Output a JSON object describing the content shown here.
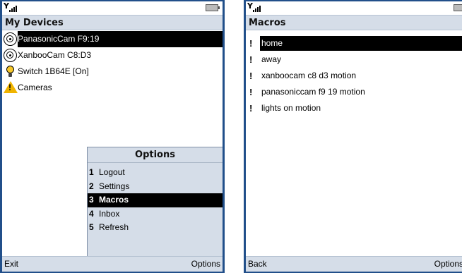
{
  "left_screen": {
    "title": "My Devices",
    "signal_glyph": "Y",
    "items": [
      {
        "label": "PanasonicCam F9:19",
        "icon": "camera-icon",
        "selected": true
      },
      {
        "label": "XanbooCam C8:D3",
        "icon": "camera-icon",
        "selected": false
      },
      {
        "label": "Switch 1B64E [On]",
        "icon": "lightbulb-icon",
        "selected": false
      },
      {
        "label": "Cameras",
        "icon": "warning-icon",
        "selected": false
      }
    ],
    "menu": {
      "title": "Options",
      "items": [
        {
          "num": "1",
          "label": "Logout"
        },
        {
          "num": "2",
          "label": "Settings"
        },
        {
          "num": "3",
          "label": "Macros",
          "selected": true
        },
        {
          "num": "4",
          "label": "Inbox"
        },
        {
          "num": "5",
          "label": "Refresh"
        }
      ]
    },
    "softkeys": {
      "left": "Exit",
      "right": "Options"
    }
  },
  "right_screen": {
    "title": "Macros",
    "signal_glyph": "Y",
    "items": [
      {
        "mark": "!",
        "label": "home",
        "selected": true
      },
      {
        "mark": "!",
        "label": "away"
      },
      {
        "mark": "!",
        "label": "xanboocam c8 d3 motion"
      },
      {
        "mark": "!",
        "label": "panasoniccam f9 19 motion"
      },
      {
        "mark": "!",
        "label": "lights on motion"
      }
    ],
    "softkeys": {
      "left": "Back",
      "right": "Options"
    }
  },
  "colors": {
    "frame": "#214f8a",
    "titlebar": "#d5dde8",
    "selection": "#000000",
    "bulb": "#f7c82a",
    "warning": "#f0b400"
  }
}
